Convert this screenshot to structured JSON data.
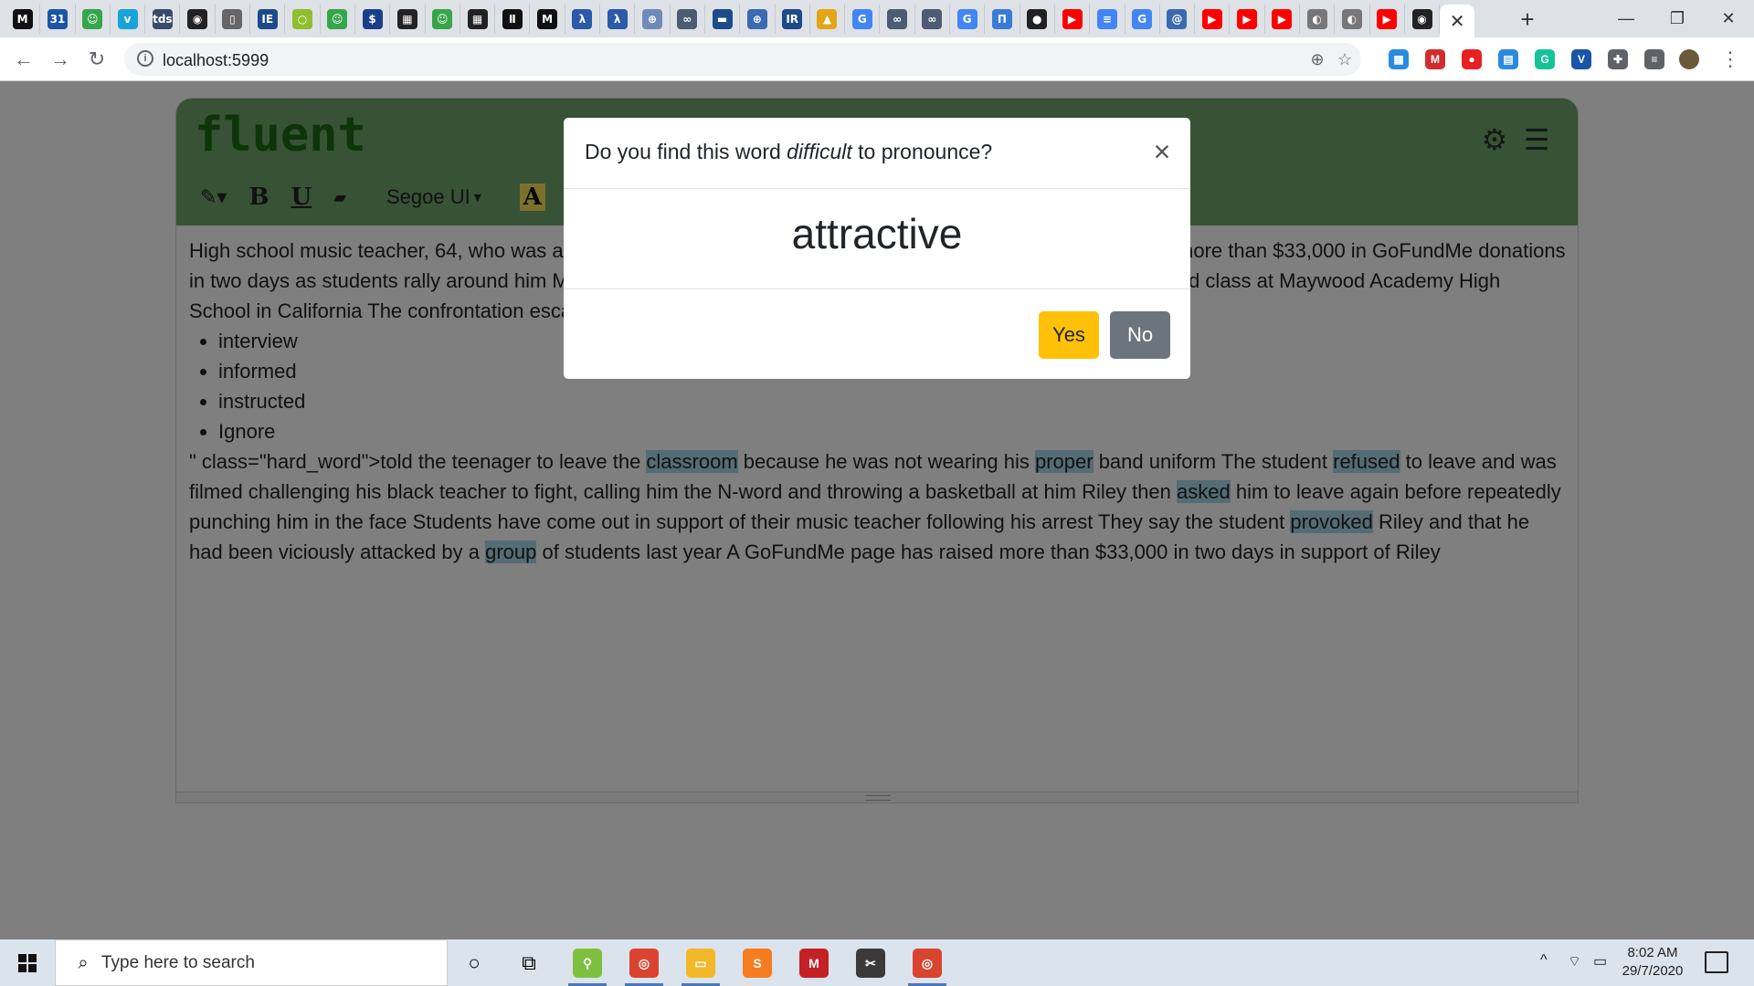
{
  "browser": {
    "url": "localhost:5999",
    "tab_favicons": [
      {
        "icon": "medium-icon",
        "glyph": "M",
        "color": "#111111"
      },
      {
        "icon": "calendar-icon",
        "glyph": "31",
        "color": "#1a55a8"
      },
      {
        "icon": "smiley-icon",
        "glyph": "☺",
        "color": "#36a64a"
      },
      {
        "icon": "vimeo-icon",
        "glyph": "v",
        "color": "#1aa3d8"
      },
      {
        "icon": "tds-icon",
        "glyph": "tds",
        "color": "#3a4a6a"
      },
      {
        "icon": "github-icon",
        "glyph": "◉",
        "color": "#222222"
      },
      {
        "icon": "document-icon",
        "glyph": "▯",
        "color": "#666666"
      },
      {
        "icon": "ieee-icon",
        "glyph": "IE",
        "color": "#1d4a8a"
      },
      {
        "icon": "circle-icon",
        "glyph": "○",
        "color": "#8fbf2e"
      },
      {
        "icon": "smiley-icon",
        "glyph": "☺",
        "color": "#36a64a"
      },
      {
        "icon": "dollar-icon",
        "glyph": "$",
        "color": "#1a3f8a"
      },
      {
        "icon": "qr-icon",
        "glyph": "▦",
        "color": "#222222"
      },
      {
        "icon": "smiley-icon",
        "glyph": "☺",
        "color": "#36a64a"
      },
      {
        "icon": "qr-icon",
        "glyph": "▦",
        "color": "#222222"
      },
      {
        "icon": "pause-icon",
        "glyph": "Ⅱ",
        "color": "#111111"
      },
      {
        "icon": "medium-icon",
        "glyph": "M",
        "color": "#111111"
      },
      {
        "icon": "ai-icon",
        "glyph": "λ",
        "color": "#2a5aa8"
      },
      {
        "icon": "ai-icon",
        "glyph": "λ",
        "color": "#2a5aa8"
      },
      {
        "icon": "globe-icon",
        "glyph": "⊕",
        "color": "#6f8bb8"
      },
      {
        "icon": "link-icon",
        "glyph": "∞",
        "color": "#4d5b73"
      },
      {
        "icon": "ieee-icon",
        "glyph": "▬",
        "color": "#1d4a8a"
      },
      {
        "icon": "globe-icon",
        "glyph": "⊕",
        "color": "#3a6ab0"
      },
      {
        "icon": "ieee-icon",
        "glyph": "IR",
        "color": "#1d4a8a"
      },
      {
        "icon": "warning-icon",
        "glyph": "▲",
        "color": "#e3a617"
      },
      {
        "icon": "google-icon",
        "glyph": "G",
        "color": "#4285f4"
      },
      {
        "icon": "link-icon",
        "glyph": "∞",
        "color": "#4d5b73"
      },
      {
        "icon": "link-icon",
        "glyph": "∞",
        "color": "#4d5b73"
      },
      {
        "icon": "google-icon",
        "glyph": "G",
        "color": "#4285f4"
      },
      {
        "icon": "tool-icon",
        "glyph": "П",
        "color": "#3a7bd5"
      },
      {
        "icon": "dark-icon",
        "glyph": "●",
        "color": "#222222"
      },
      {
        "icon": "youtube-icon",
        "glyph": "▶",
        "color": "#ff0000"
      },
      {
        "icon": "docs-icon",
        "glyph": "≡",
        "color": "#4285f4"
      },
      {
        "icon": "google-icon",
        "glyph": "G",
        "color": "#4285f4"
      },
      {
        "icon": "at-icon",
        "glyph": "@",
        "color": "#3a6ab0"
      },
      {
        "icon": "youtube-icon",
        "glyph": "▶",
        "color": "#ff0000"
      },
      {
        "icon": "youtube-icon",
        "glyph": "▶",
        "color": "#ff0000"
      },
      {
        "icon": "youtube-icon",
        "glyph": "▶",
        "color": "#ff0000"
      },
      {
        "icon": "globe-icon",
        "glyph": "◐",
        "color": "#777777"
      },
      {
        "icon": "globe-icon",
        "glyph": "◐",
        "color": "#777777"
      },
      {
        "icon": "youtube-icon",
        "glyph": "▶",
        "color": "#ff0000"
      },
      {
        "icon": "github-icon",
        "glyph": "◉",
        "color": "#222222"
      }
    ],
    "active_tab_close": "✕",
    "new_tab": "+",
    "window": {
      "minimize": "—",
      "maximize": "❐",
      "close": "✕"
    },
    "nav": {
      "back": "←",
      "forward": "→",
      "reload": "↻"
    },
    "omnibox_icons": {
      "zoom": "⊕",
      "bookmark": "☆"
    },
    "extensions": [
      {
        "icon": "extension-calendar-icon",
        "glyph": "▦",
        "color": "#2a8ae0"
      },
      {
        "icon": "extension-mendeley-icon",
        "glyph": "M",
        "color": "#d12d2d"
      },
      {
        "icon": "extension-adblock-icon",
        "glyph": "●",
        "color": "#e62121"
      },
      {
        "icon": "extension-note-icon",
        "glyph": "▤",
        "color": "#2a8ae0"
      },
      {
        "icon": "extension-grammarly-icon",
        "glyph": "G",
        "color": "#15c39a"
      },
      {
        "icon": "extension-vimium-icon",
        "glyph": "V",
        "color": "#1a55a8"
      },
      {
        "icon": "extension-puzzle-icon",
        "glyph": "✚",
        "color": "#5f6368"
      },
      {
        "icon": "media-control-icon",
        "glyph": "≡",
        "color": "#5f6368"
      }
    ],
    "menu_glyph": "⋮"
  },
  "app": {
    "logo": "fluent",
    "toolbar": {
      "magic": "✎▾",
      "bold": "B",
      "underline": "U",
      "eraser": "▰",
      "font": "Segoe UI",
      "font_caret": "▾",
      "highlight": "A"
    },
    "header_icons": {
      "settings": "⚙",
      "menu": "☰"
    },
    "content": {
      "para1": "High school music teacher, 64, who was arrested for punching a student who called him the N-word has raised more than $33,000 in GoFundMe donations in two days as students rally around him Marcus Riley, 64, was arrested after he punched a student during a band class at Maywood Academy High School in California The confrontation escalated after Riley",
      "list": [
        "interview",
        "informed",
        "instructed",
        "Ignore"
      ],
      "para2": [
        {
          "t": "\" class=\"hard_word\">told the teenager to leave the ",
          "hw": false
        },
        {
          "t": "classroom",
          "hw": true
        },
        {
          "t": " because he was not wearing his ",
          "hw": false
        },
        {
          "t": "proper",
          "hw": true
        },
        {
          "t": " band uniform The student ",
          "hw": false
        },
        {
          "t": "refused",
          "hw": true
        },
        {
          "t": " to leave and was filmed challenging his black teacher to fight, calling him the N-word and throwing a basketball at him Riley then ",
          "hw": false
        },
        {
          "t": "asked",
          "hw": true
        },
        {
          "t": " him to leave again before repeatedly punching him in the face Students have come out in support of their music teacher following his arrest They say the student ",
          "hw": false
        },
        {
          "t": "provoked",
          "hw": true
        },
        {
          "t": " Riley and that he had been viciously attacked by a ",
          "hw": false
        },
        {
          "t": "group",
          "hw": true
        },
        {
          "t": " of students last year A GoFundMe page has raised more than $33,000 in two days in support of Riley",
          "hw": false
        }
      ]
    }
  },
  "modal": {
    "title_before": "Do you find this word ",
    "title_em": "difficult",
    "title_after": " to pronounce?",
    "close": "×",
    "word": "attractive",
    "yes": "Yes",
    "no": "No"
  },
  "taskbar": {
    "search_placeholder": "Type here to search",
    "cortana": "○",
    "task_view": "⧉",
    "apps": [
      {
        "icon": "evolution-app-icon",
        "glyph": "⚲",
        "color": "#7fbf3f"
      },
      {
        "icon": "chrome-app-icon",
        "glyph": "◎",
        "color": "#d9432f"
      },
      {
        "icon": "file-explorer-icon",
        "glyph": "▭",
        "color": "#f2b829"
      },
      {
        "icon": "sublime-text-icon",
        "glyph": "S",
        "color": "#f57c1f"
      },
      {
        "icon": "mendeley-app-icon",
        "glyph": "M",
        "color": "#c42126"
      },
      {
        "icon": "snipping-tool-icon",
        "glyph": "✂",
        "color": "#3a3a3a"
      },
      {
        "icon": "chrome-app-icon",
        "glyph": "◎",
        "color": "#d9432f"
      }
    ],
    "tray": {
      "chevron": "^",
      "wifi": "⌔",
      "battery": "▭"
    },
    "time": "8:02 AM",
    "date": "29/7/2020"
  }
}
